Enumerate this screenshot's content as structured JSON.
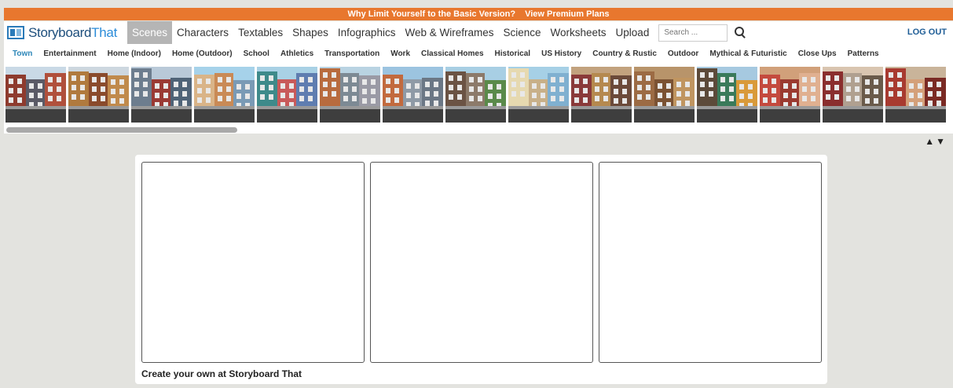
{
  "banner": {
    "promo": "Why Limit Yourself to the Basic Version?",
    "link": "View Premium Plans",
    "color": "#e8772e"
  },
  "brand": {
    "name": "Storyboard",
    "name_accent": "That"
  },
  "nav": {
    "items": [
      {
        "label": "Scenes",
        "active": true
      },
      {
        "label": "Characters"
      },
      {
        "label": "Textables"
      },
      {
        "label": "Shapes"
      },
      {
        "label": "Infographics"
      },
      {
        "label": "Web & Wireframes"
      },
      {
        "label": "Science"
      },
      {
        "label": "Worksheets"
      },
      {
        "label": "Upload"
      }
    ],
    "search_placeholder": "Search ...",
    "logout": "LOG OUT"
  },
  "categories": {
    "items": [
      "Town",
      "Entertainment",
      "Home (Indoor)",
      "Home (Outdoor)",
      "School",
      "Athletics",
      "Transportation",
      "Work",
      "Classical Homes",
      "Historical",
      "US History",
      "Country & Rustic",
      "Outdoor",
      "Mythical & Futuristic",
      "Close Ups",
      "Patterns"
    ],
    "active_index": 0,
    "active_color": "#2c86b8"
  },
  "scenes": {
    "thumbnails": [
      {
        "name": "town-rowhouses",
        "sky": "#c9d9e6",
        "colors": [
          "#8e3b2e",
          "#5a5a66",
          "#b0503c"
        ]
      },
      {
        "name": "town-brownstones",
        "sky": "#cdd7df",
        "colors": [
          "#b07a3e",
          "#8a4b2c",
          "#c08a4c"
        ]
      },
      {
        "name": "town-downtown",
        "sky": "#b9c9d8",
        "colors": [
          "#6d7d8e",
          "#9a3a34",
          "#4f6377"
        ]
      },
      {
        "name": "town-main-street",
        "sky": "#a6d2ea",
        "colors": [
          "#d9b488",
          "#c98a56",
          "#7a9ab5"
        ]
      },
      {
        "name": "town-shops",
        "sky": "#a9d1e5",
        "colors": [
          "#3e8a8a",
          "#c85a5a",
          "#5f7db0"
        ]
      },
      {
        "name": "town-square",
        "sky": "#b9d3e2",
        "colors": [
          "#b86b3e",
          "#7d8a94",
          "#9a9aa5"
        ]
      },
      {
        "name": "town-skyline",
        "sky": "#9cc4e0",
        "colors": [
          "#c26a3e",
          "#8f9aa6",
          "#6b7785"
        ]
      },
      {
        "name": "town-park",
        "sky": "#a8cfe4",
        "colors": [
          "#6b5344",
          "#8c7a6a",
          "#5a8a4a"
        ]
      },
      {
        "name": "town-crosswalk",
        "sky": "#a6d0e6",
        "colors": [
          "#e6d9b0",
          "#c8b089",
          "#80b0d0"
        ]
      },
      {
        "name": "town-street-corner",
        "sky": "#c2a27e",
        "colors": [
          "#8a3a3a",
          "#b5894f",
          "#6b4a3a"
        ]
      },
      {
        "name": "town-doorway",
        "sky": "#b8946a",
        "colors": [
          "#9c6b44",
          "#7b5233",
          "#c09560"
        ]
      },
      {
        "name": "town-storefront",
        "sky": "#a6c9e0",
        "colors": [
          "#5c4a3a",
          "#3a7a5a",
          "#d99a3a"
        ]
      },
      {
        "name": "town-apartments",
        "sky": "#d1a07a",
        "colors": [
          "#c44a3e",
          "#9a3a30",
          "#e0b090"
        ]
      },
      {
        "name": "town-shopfront",
        "sky": "#d9c5b0",
        "colors": [
          "#8a2e2e",
          "#b0a090",
          "#6a5a4a"
        ]
      },
      {
        "name": "town-brick-row",
        "sky": "#c9b49a",
        "colors": [
          "#a83a30",
          "#d4a07a",
          "#7a2a24"
        ]
      }
    ]
  },
  "board": {
    "cells": [
      "cell-1",
      "cell-2",
      "cell-3"
    ],
    "footer": "Create your own at Storyboard That"
  }
}
